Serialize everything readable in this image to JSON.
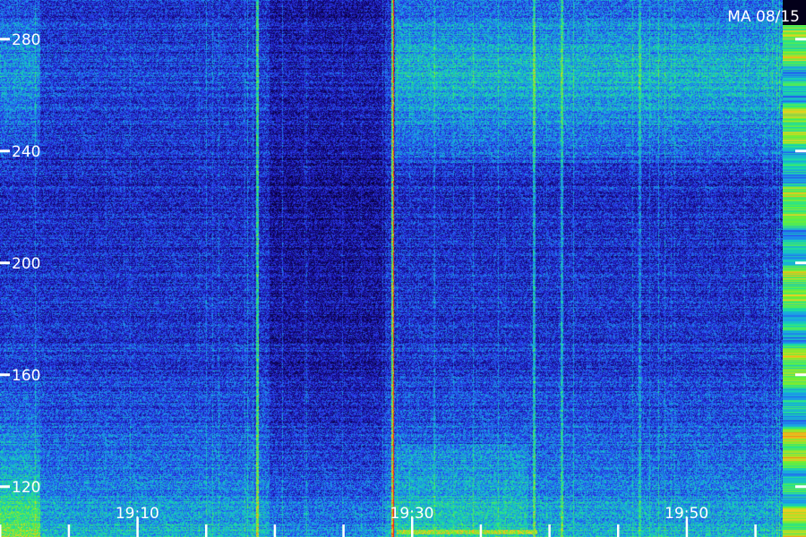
{
  "chart_data": {
    "type": "heatmap",
    "title": "MA 08/15",
    "y_ticks": [
      120,
      160,
      200,
      240,
      280
    ],
    "ylim": [
      102,
      294
    ],
    "x_ticks": [
      "19:10",
      "19:30",
      "19:50"
    ],
    "x_range_minutes": [
      "19:00",
      "19:57"
    ],
    "minor_x_tick_interval_minutes": 5,
    "colorscale": [
      "#05012a",
      "#170a8c",
      "#2a3cf0",
      "#1aa0e8",
      "#18e0a0",
      "#6ef032",
      "#f0d020",
      "#f06010",
      "#ff1010"
    ],
    "grid": false,
    "legend": "right-edge color bar"
  }
}
